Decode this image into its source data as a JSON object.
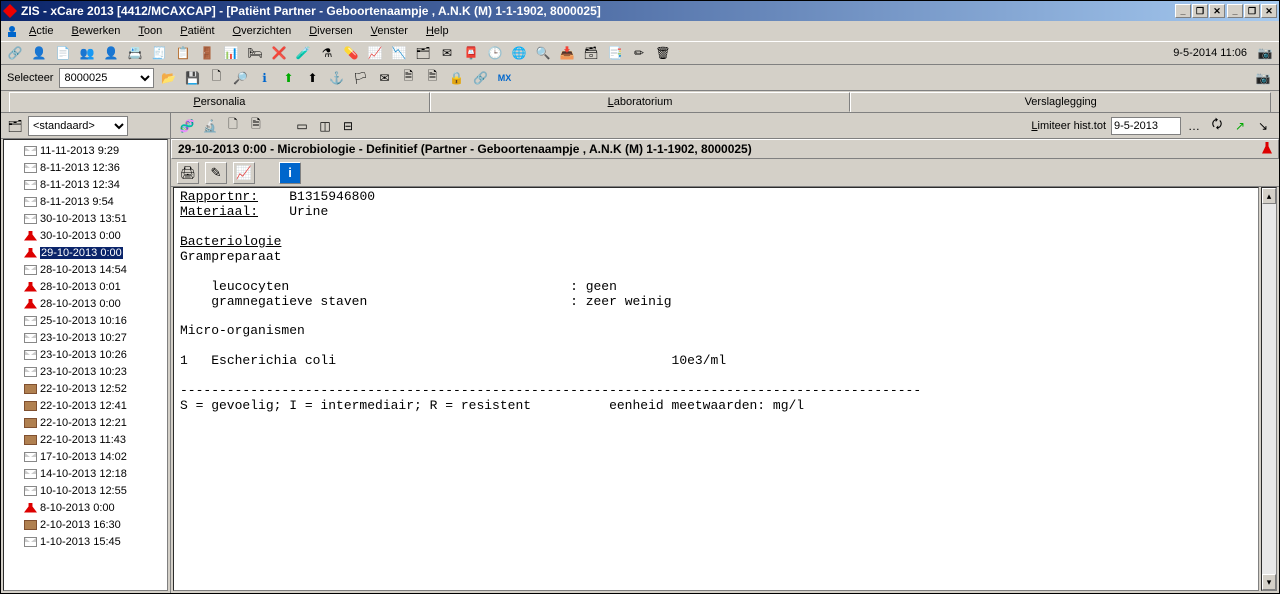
{
  "window": {
    "title": "ZIS - xCare 2013 [4412/MCAXCAP] - [Patiënt Partner - Geboortenaampje , A.N.K (M) 1-1-1902, 8000025]"
  },
  "menubar": {
    "items": [
      "Actie",
      "Bewerken",
      "Toon",
      "Patiënt",
      "Overzichten",
      "Diversen",
      "Venster",
      "Help"
    ]
  },
  "toolbar": {
    "datetime": "9-5-2014 11:06"
  },
  "toolbar2": {
    "select_label": "Selecteer",
    "select_value": "8000025"
  },
  "tabs": {
    "items": [
      "Personalia",
      "Laboratorium",
      "Verslaglegging"
    ],
    "active": 1
  },
  "sidebar": {
    "filter_value": "<standaard>",
    "items": [
      {
        "icon": "mail",
        "label": "11-11-2013 9:29"
      },
      {
        "icon": "mail",
        "label": "8-11-2013 12:36"
      },
      {
        "icon": "mail",
        "label": "8-11-2013 12:34"
      },
      {
        "icon": "mail",
        "label": "8-11-2013 9:54"
      },
      {
        "icon": "mail",
        "label": "30-10-2013 13:51"
      },
      {
        "icon": "flask",
        "label": "30-10-2013 0:00"
      },
      {
        "icon": "flask",
        "label": "29-10-2013 0:00",
        "selected": true
      },
      {
        "icon": "mail",
        "label": "28-10-2013 14:54"
      },
      {
        "icon": "flask",
        "label": "28-10-2013 0:01"
      },
      {
        "icon": "flask",
        "label": "28-10-2013 0:00"
      },
      {
        "icon": "mail",
        "label": "25-10-2013 10:16"
      },
      {
        "icon": "mail",
        "label": "23-10-2013 10:27"
      },
      {
        "icon": "mail",
        "label": "23-10-2013 10:26"
      },
      {
        "icon": "mail",
        "label": "23-10-2013 10:23"
      },
      {
        "icon": "card",
        "label": "22-10-2013 12:52"
      },
      {
        "icon": "card",
        "label": "22-10-2013 12:41"
      },
      {
        "icon": "card",
        "label": "22-10-2013 12:21"
      },
      {
        "icon": "card",
        "label": "22-10-2013 11:43"
      },
      {
        "icon": "mail",
        "label": "17-10-2013 14:02"
      },
      {
        "icon": "mail",
        "label": "14-10-2013 12:18"
      },
      {
        "icon": "mail",
        "label": "10-10-2013 12:55"
      },
      {
        "icon": "flask",
        "label": "8-10-2013 0:00"
      },
      {
        "icon": "card",
        "label": "2-10-2013 16:30"
      },
      {
        "icon": "mail",
        "label": "1-10-2013 15:45"
      }
    ]
  },
  "main": {
    "limit_label": "Limiteer hist.tot",
    "limit_date": "9-5-2013",
    "report_title": "29-10-2013 0:00 - Microbiologie - Definitief (Partner - Geboortenaampje , A.N.K (M) 1-1-1902, 8000025)",
    "report": {
      "line1_key": "Rapportnr:",
      "line1_val": "B1315946800",
      "line2_key": "Materiaal:",
      "line2_val": "Urine",
      "section1": "Bacteriologie",
      "sub1": "Grampreparaat",
      "row1_name": "leucocyten",
      "row1_val": ": geen",
      "row2_name": "gramnegatieve staven",
      "row2_val": ": zeer weinig",
      "section2": "Micro-organismen",
      "org_idx": "1",
      "org_name": "Escherichia coli",
      "org_val": "10e3/ml",
      "divider": "-----------------------------------------------------------------------------------------------",
      "legend": "S = gevoelig; I = intermediair; R = resistent          eenheid meetwaarden: mg/l"
    }
  }
}
